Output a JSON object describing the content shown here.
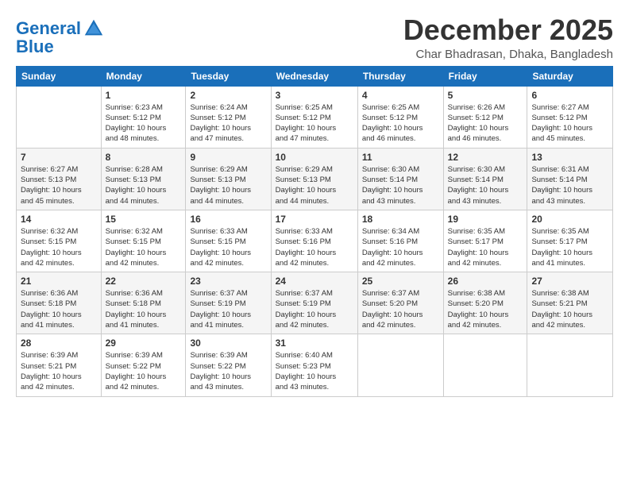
{
  "header": {
    "logo_line1": "General",
    "logo_line2": "Blue",
    "month": "December 2025",
    "location": "Char Bhadrasan, Dhaka, Bangladesh"
  },
  "weekdays": [
    "Sunday",
    "Monday",
    "Tuesday",
    "Wednesday",
    "Thursday",
    "Friday",
    "Saturday"
  ],
  "weeks": [
    [
      {
        "day": "",
        "info": ""
      },
      {
        "day": "1",
        "info": "Sunrise: 6:23 AM\nSunset: 5:12 PM\nDaylight: 10 hours\nand 48 minutes."
      },
      {
        "day": "2",
        "info": "Sunrise: 6:24 AM\nSunset: 5:12 PM\nDaylight: 10 hours\nand 47 minutes."
      },
      {
        "day": "3",
        "info": "Sunrise: 6:25 AM\nSunset: 5:12 PM\nDaylight: 10 hours\nand 47 minutes."
      },
      {
        "day": "4",
        "info": "Sunrise: 6:25 AM\nSunset: 5:12 PM\nDaylight: 10 hours\nand 46 minutes."
      },
      {
        "day": "5",
        "info": "Sunrise: 6:26 AM\nSunset: 5:12 PM\nDaylight: 10 hours\nand 46 minutes."
      },
      {
        "day": "6",
        "info": "Sunrise: 6:27 AM\nSunset: 5:12 PM\nDaylight: 10 hours\nand 45 minutes."
      }
    ],
    [
      {
        "day": "7",
        "info": "Sunrise: 6:27 AM\nSunset: 5:13 PM\nDaylight: 10 hours\nand 45 minutes."
      },
      {
        "day": "8",
        "info": "Sunrise: 6:28 AM\nSunset: 5:13 PM\nDaylight: 10 hours\nand 44 minutes."
      },
      {
        "day": "9",
        "info": "Sunrise: 6:29 AM\nSunset: 5:13 PM\nDaylight: 10 hours\nand 44 minutes."
      },
      {
        "day": "10",
        "info": "Sunrise: 6:29 AM\nSunset: 5:13 PM\nDaylight: 10 hours\nand 44 minutes."
      },
      {
        "day": "11",
        "info": "Sunrise: 6:30 AM\nSunset: 5:14 PM\nDaylight: 10 hours\nand 43 minutes."
      },
      {
        "day": "12",
        "info": "Sunrise: 6:30 AM\nSunset: 5:14 PM\nDaylight: 10 hours\nand 43 minutes."
      },
      {
        "day": "13",
        "info": "Sunrise: 6:31 AM\nSunset: 5:14 PM\nDaylight: 10 hours\nand 43 minutes."
      }
    ],
    [
      {
        "day": "14",
        "info": "Sunrise: 6:32 AM\nSunset: 5:15 PM\nDaylight: 10 hours\nand 42 minutes."
      },
      {
        "day": "15",
        "info": "Sunrise: 6:32 AM\nSunset: 5:15 PM\nDaylight: 10 hours\nand 42 minutes."
      },
      {
        "day": "16",
        "info": "Sunrise: 6:33 AM\nSunset: 5:15 PM\nDaylight: 10 hours\nand 42 minutes."
      },
      {
        "day": "17",
        "info": "Sunrise: 6:33 AM\nSunset: 5:16 PM\nDaylight: 10 hours\nand 42 minutes."
      },
      {
        "day": "18",
        "info": "Sunrise: 6:34 AM\nSunset: 5:16 PM\nDaylight: 10 hours\nand 42 minutes."
      },
      {
        "day": "19",
        "info": "Sunrise: 6:35 AM\nSunset: 5:17 PM\nDaylight: 10 hours\nand 42 minutes."
      },
      {
        "day": "20",
        "info": "Sunrise: 6:35 AM\nSunset: 5:17 PM\nDaylight: 10 hours\nand 41 minutes."
      }
    ],
    [
      {
        "day": "21",
        "info": "Sunrise: 6:36 AM\nSunset: 5:18 PM\nDaylight: 10 hours\nand 41 minutes."
      },
      {
        "day": "22",
        "info": "Sunrise: 6:36 AM\nSunset: 5:18 PM\nDaylight: 10 hours\nand 41 minutes."
      },
      {
        "day": "23",
        "info": "Sunrise: 6:37 AM\nSunset: 5:19 PM\nDaylight: 10 hours\nand 41 minutes."
      },
      {
        "day": "24",
        "info": "Sunrise: 6:37 AM\nSunset: 5:19 PM\nDaylight: 10 hours\nand 42 minutes."
      },
      {
        "day": "25",
        "info": "Sunrise: 6:37 AM\nSunset: 5:20 PM\nDaylight: 10 hours\nand 42 minutes."
      },
      {
        "day": "26",
        "info": "Sunrise: 6:38 AM\nSunset: 5:20 PM\nDaylight: 10 hours\nand 42 minutes."
      },
      {
        "day": "27",
        "info": "Sunrise: 6:38 AM\nSunset: 5:21 PM\nDaylight: 10 hours\nand 42 minutes."
      }
    ],
    [
      {
        "day": "28",
        "info": "Sunrise: 6:39 AM\nSunset: 5:21 PM\nDaylight: 10 hours\nand 42 minutes."
      },
      {
        "day": "29",
        "info": "Sunrise: 6:39 AM\nSunset: 5:22 PM\nDaylight: 10 hours\nand 42 minutes."
      },
      {
        "day": "30",
        "info": "Sunrise: 6:39 AM\nSunset: 5:22 PM\nDaylight: 10 hours\nand 43 minutes."
      },
      {
        "day": "31",
        "info": "Sunrise: 6:40 AM\nSunset: 5:23 PM\nDaylight: 10 hours\nand 43 minutes."
      },
      {
        "day": "",
        "info": ""
      },
      {
        "day": "",
        "info": ""
      },
      {
        "day": "",
        "info": ""
      }
    ]
  ]
}
